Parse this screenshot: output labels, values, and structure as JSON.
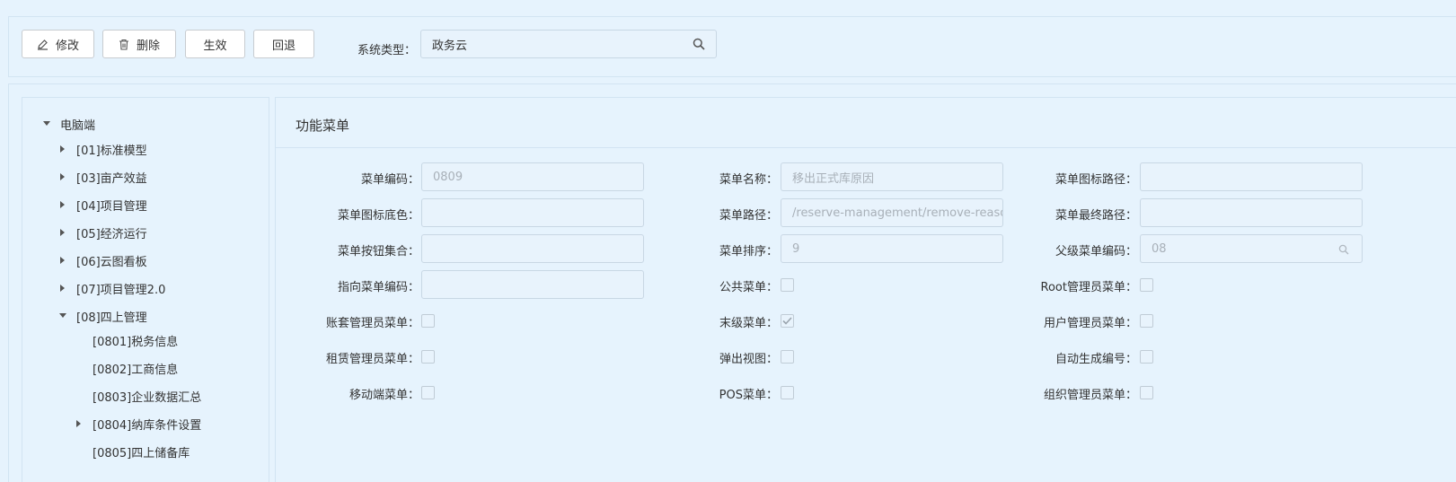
{
  "toolbar": {
    "edit_label": "修改",
    "delete_label": "删除",
    "apply_label": "生效",
    "rollback_label": "回退",
    "system_type_label": "系统类型：",
    "system_type_value": "政务云"
  },
  "tree": {
    "root": "电脑端",
    "items": [
      "[01]标准模型",
      "[03]亩产效益",
      "[04]项目管理",
      "[05]经济运行",
      "[06]云图看板",
      "[07]项目管理2.0",
      "[08]四上管理"
    ],
    "children": [
      "[0801]税务信息",
      "[0802]工商信息",
      "[0803]企业数据汇总",
      "[0804]纳库条件设置",
      "[0805]四上储备库"
    ]
  },
  "form": {
    "title": "功能菜单",
    "menu_code_label": "菜单编码：",
    "menu_code_value": "0809",
    "menu_name_label": "菜单名称：",
    "menu_name_value": "移出正式库原因",
    "icon_path_label": "菜单图标路径：",
    "icon_path_value": "",
    "icon_bg_label": "菜单图标底色：",
    "icon_bg_value": "",
    "menu_path_label": "菜单路径：",
    "menu_path_value": "/reserve-management/remove-reaso",
    "final_path_label": "菜单最终路径：",
    "final_path_value": "",
    "button_set_label": "菜单按钮集合：",
    "button_set_value": "",
    "sort_label": "菜单排序：",
    "sort_value": "9",
    "parent_code_label": "父级菜单编码：",
    "parent_code_value": "08",
    "target_code_label": "指向菜单编码：",
    "target_code_value": "",
    "public_menu_label": "公共菜单：",
    "root_admin_label": "Root管理员菜单：",
    "ledger_admin_label": "账套管理员菜单：",
    "leaf_menu_label": "末级菜单：",
    "user_admin_label": "用户管理员菜单：",
    "lease_admin_label": "租赁管理员菜单：",
    "popup_view_label": "弹出视图：",
    "auto_code_label": "自动生成编号：",
    "mobile_menu_label": "移动端菜单：",
    "pos_menu_label": "POS菜单：",
    "org_admin_label": "组织管理员菜单："
  }
}
